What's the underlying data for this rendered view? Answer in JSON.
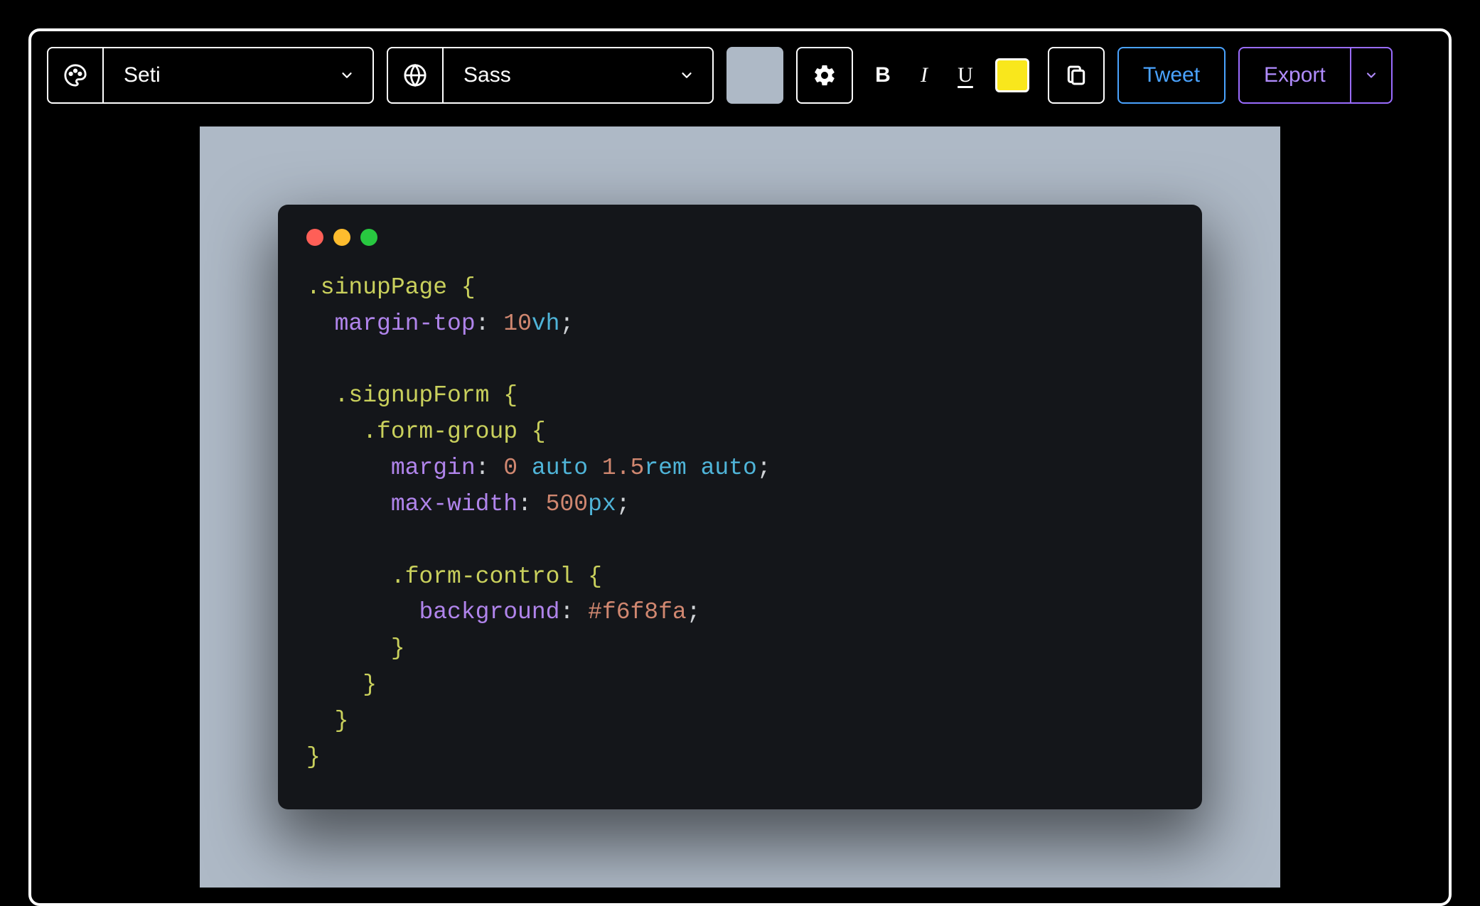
{
  "toolbar": {
    "theme": {
      "value": "Seti"
    },
    "language": {
      "value": "Sass"
    },
    "bg_swatch_color": "#aeb9c6",
    "format": {
      "bold": "B",
      "italic": "I",
      "underline": "U"
    },
    "highlight_color": "#f9e71c",
    "tweet_label": "Tweet",
    "export_label": "Export"
  },
  "canvas": {
    "bg_color": "#aeb9c6",
    "window_bg": "#14161a",
    "traffic_lights": [
      "#ff5f57",
      "#febc2e",
      "#28c840"
    ]
  },
  "code": {
    "language": "sass",
    "theme": "Seti",
    "lines": [
      {
        "indent": 0,
        "tokens": [
          {
            "t": "sel",
            "v": ".sinupPage"
          },
          {
            "t": "punc",
            "v": " "
          },
          {
            "t": "sel",
            "v": "{"
          }
        ]
      },
      {
        "indent": 1,
        "tokens": [
          {
            "t": "prop",
            "v": "margin-top"
          },
          {
            "t": "punc",
            "v": ": "
          },
          {
            "t": "num",
            "v": "10"
          },
          {
            "t": "unit",
            "v": "vh"
          },
          {
            "t": "punc",
            "v": ";"
          }
        ]
      },
      {
        "indent": 0,
        "tokens": []
      },
      {
        "indent": 1,
        "tokens": [
          {
            "t": "sel",
            "v": ".signupForm"
          },
          {
            "t": "punc",
            "v": " "
          },
          {
            "t": "sel",
            "v": "{"
          }
        ]
      },
      {
        "indent": 2,
        "tokens": [
          {
            "t": "sel",
            "v": ".form-group"
          },
          {
            "t": "punc",
            "v": " "
          },
          {
            "t": "sel",
            "v": "{"
          }
        ]
      },
      {
        "indent": 3,
        "tokens": [
          {
            "t": "prop",
            "v": "margin"
          },
          {
            "t": "punc",
            "v": ": "
          },
          {
            "t": "num",
            "v": "0"
          },
          {
            "t": "punc",
            "v": " "
          },
          {
            "t": "kw",
            "v": "auto"
          },
          {
            "t": "punc",
            "v": " "
          },
          {
            "t": "num",
            "v": "1.5"
          },
          {
            "t": "unit",
            "v": "rem"
          },
          {
            "t": "punc",
            "v": " "
          },
          {
            "t": "kw",
            "v": "auto"
          },
          {
            "t": "punc",
            "v": ";"
          }
        ]
      },
      {
        "indent": 3,
        "tokens": [
          {
            "t": "prop",
            "v": "max-width"
          },
          {
            "t": "punc",
            "v": ": "
          },
          {
            "t": "num",
            "v": "500"
          },
          {
            "t": "unit",
            "v": "px"
          },
          {
            "t": "punc",
            "v": ";"
          }
        ]
      },
      {
        "indent": 0,
        "tokens": []
      },
      {
        "indent": 3,
        "tokens": [
          {
            "t": "sel",
            "v": ".form-control"
          },
          {
            "t": "punc",
            "v": " "
          },
          {
            "t": "sel",
            "v": "{"
          }
        ]
      },
      {
        "indent": 4,
        "tokens": [
          {
            "t": "prop",
            "v": "background"
          },
          {
            "t": "punc",
            "v": ": "
          },
          {
            "t": "hex",
            "v": "#f6f8fa"
          },
          {
            "t": "punc",
            "v": ";"
          }
        ]
      },
      {
        "indent": 3,
        "tokens": [
          {
            "t": "sel",
            "v": "}"
          }
        ]
      },
      {
        "indent": 2,
        "tokens": [
          {
            "t": "sel",
            "v": "}"
          }
        ]
      },
      {
        "indent": 1,
        "tokens": [
          {
            "t": "sel",
            "v": "}"
          }
        ]
      },
      {
        "indent": 0,
        "tokens": [
          {
            "t": "sel",
            "v": "}"
          }
        ]
      }
    ]
  }
}
